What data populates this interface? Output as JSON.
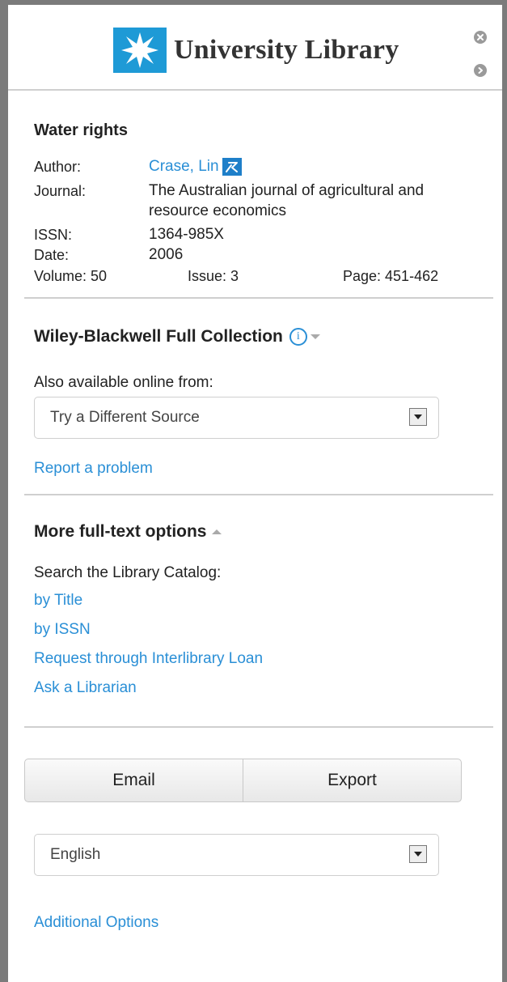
{
  "header": {
    "title": "University Library",
    "brand_color": "#1e9ad6",
    "close_icon": "close-icon",
    "next_icon": "chevron-right-icon"
  },
  "record": {
    "title": "Water rights",
    "author_label": "Author:",
    "author_value": "Crase, Lin",
    "journal_label": "Journal:",
    "journal_value_line1": "The Australian journal of agricultural and",
    "journal_value_line2": "resource economics",
    "issn_label": "ISSN:",
    "issn_value": "1364-985X",
    "date_label": "Date:",
    "date_value": "2006",
    "volume": "Volume: 50",
    "issue": "Issue: 3",
    "page": "Page: 451-462"
  },
  "fulltext": {
    "title": "Wiley-Blackwell Full Collection",
    "also_label": "Also available online from:",
    "source_select": "Try a Different Source",
    "report_link": "Report a problem"
  },
  "more": {
    "title": "More full-text options",
    "search_label": "Search the Library Catalog:",
    "links": [
      "by Title",
      "by ISSN",
      "Request through Interlibrary Loan",
      "Ask a Librarian"
    ]
  },
  "actions": {
    "email": "Email",
    "export": "Export"
  },
  "language": {
    "selected": "English"
  },
  "footer": {
    "additional": "Additional Options"
  },
  "colors": {
    "link": "#2a8fd6",
    "frame": "#7b7b7b",
    "divider": "#cfcfcf"
  }
}
